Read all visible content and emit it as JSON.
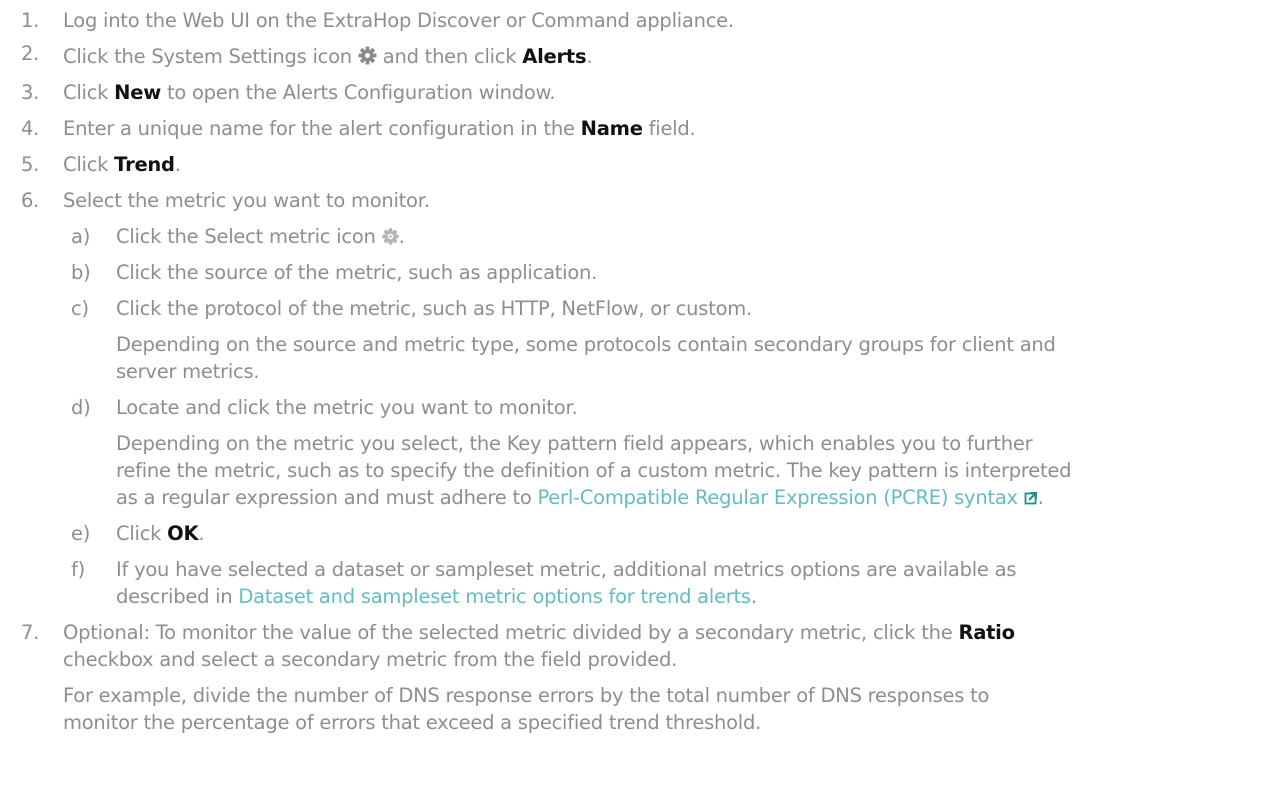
{
  "colors": {
    "text": "#8e8e8e",
    "bold": "#111111",
    "link": "#62bcc2"
  },
  "steps": [
    {
      "num": "1.",
      "text": "Log into the Web UI on the ExtraHop Discover or Command appliance."
    },
    {
      "num": "2.",
      "pre": "Click the System Settings icon",
      "icon": "gear-icon",
      "mid": "and then click",
      "bold": "Alerts",
      "post": "."
    },
    {
      "num": "3.",
      "pre": "Click",
      "bold": "New",
      "post": "to open the Alerts Configuration window."
    },
    {
      "num": "4.",
      "pre": "Enter a unique name for the alert configuration in the",
      "bold": "Name",
      "post": "field."
    },
    {
      "num": "5.",
      "pre": "Click",
      "bold": "Trend",
      "post": "."
    },
    {
      "num": "6.",
      "text": "Select the metric you want to monitor."
    },
    {
      "num": "7.",
      "pre": "Optional: To monitor the value of the selected metric divided by a secondary metric, click the",
      "bold": "Ratio",
      "line2": "checkbox and select a secondary metric from the field provided.",
      "note1": "For example, divide the number of DNS response errors by the total number of DNS responses to",
      "note2": "monitor the percentage of errors that exceed a specified trend threshold."
    }
  ],
  "substeps": [
    {
      "num": "a)",
      "pre": "Click the Select metric icon",
      "icon": "select-metric-icon",
      "post": "."
    },
    {
      "num": "b)",
      "text": "Click the source of the metric, such as application."
    },
    {
      "num": "c)",
      "text": "Click the protocol of the metric, such as HTTP, NetFlow, or custom.",
      "note1": "Depending on the source and metric type, some protocols contain secondary groups for client and",
      "note2": "server metrics."
    },
    {
      "num": "d)",
      "text": "Locate and click the metric you want to monitor.",
      "note1": "Depending on the metric you select, the Key pattern field appears, which enables you to further",
      "note2": "refine the metric, such as to specify the definition of a custom metric. The key pattern is interpreted",
      "note3_pre": "as a regular expression and must adhere to",
      "note3_link": "Perl-Compatible Regular Expression (PCRE) syntax",
      "note3_icon": "external-link-icon",
      "note3_post": "."
    },
    {
      "num": "e)",
      "pre": "Click",
      "bold": "OK",
      "post": "."
    },
    {
      "num": "f)",
      "line1": "If you have selected a dataset or sampleset metric, additional metrics options are available as",
      "line2_pre": "described in",
      "line2_link": "Dataset and sampleset metric options for trend alerts",
      "line2_post": "."
    }
  ]
}
